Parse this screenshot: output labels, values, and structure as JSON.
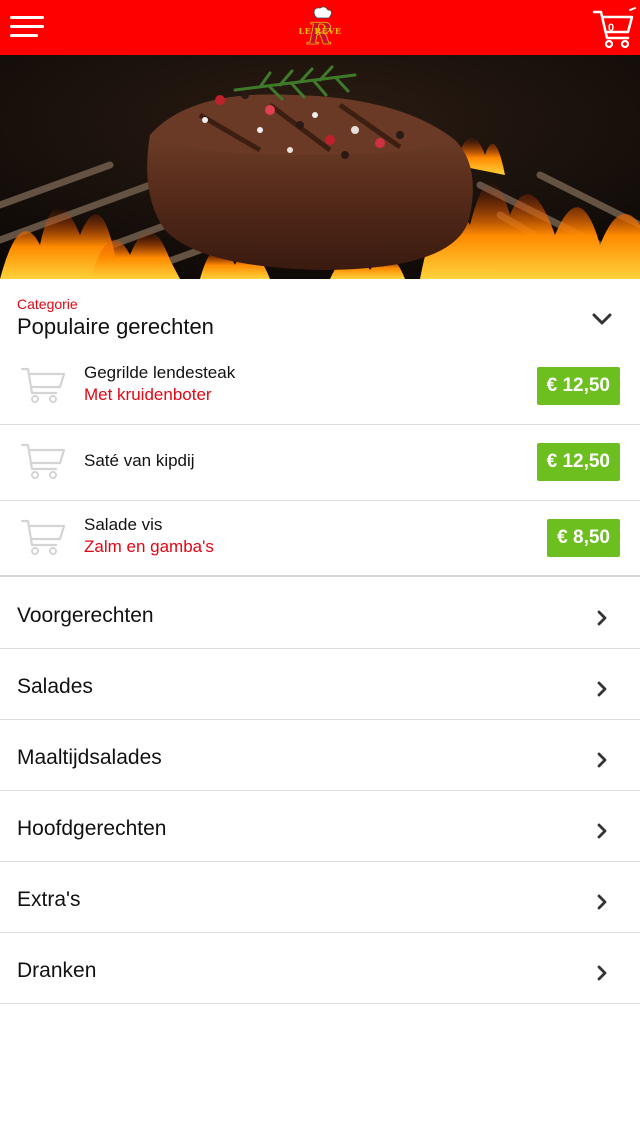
{
  "header": {
    "logo_text": "LE RÊVE",
    "cart_count": "0"
  },
  "category": {
    "label": "Categorie",
    "title": "Populaire gerechten"
  },
  "products": [
    {
      "name": "Gegrilde lendesteak",
      "subtitle": "Met kruidenboter",
      "price": "€ 12,50"
    },
    {
      "name": "Saté van kipdij",
      "subtitle": "",
      "price": "€ 12,50"
    },
    {
      "name": "Salade vis",
      "subtitle": "Zalm en gamba's",
      "price": "€ 8,50"
    }
  ],
  "categories": [
    {
      "label": "Voorgerechten"
    },
    {
      "label": "Salades"
    },
    {
      "label": "Maaltijdsalades"
    },
    {
      "label": "Hoofdgerechten"
    },
    {
      "label": "Extra's"
    },
    {
      "label": "Dranken"
    }
  ],
  "colors": {
    "header_bg": "#ff0000",
    "accent_red": "#e30613",
    "price_green": "#6cbf1e",
    "divider": "#dcdcdc"
  },
  "icons": {
    "menu": "hamburger-icon",
    "cart": "shopping-cart-icon",
    "expand": "chevron-down-icon",
    "navigate": "chevron-right-icon"
  }
}
